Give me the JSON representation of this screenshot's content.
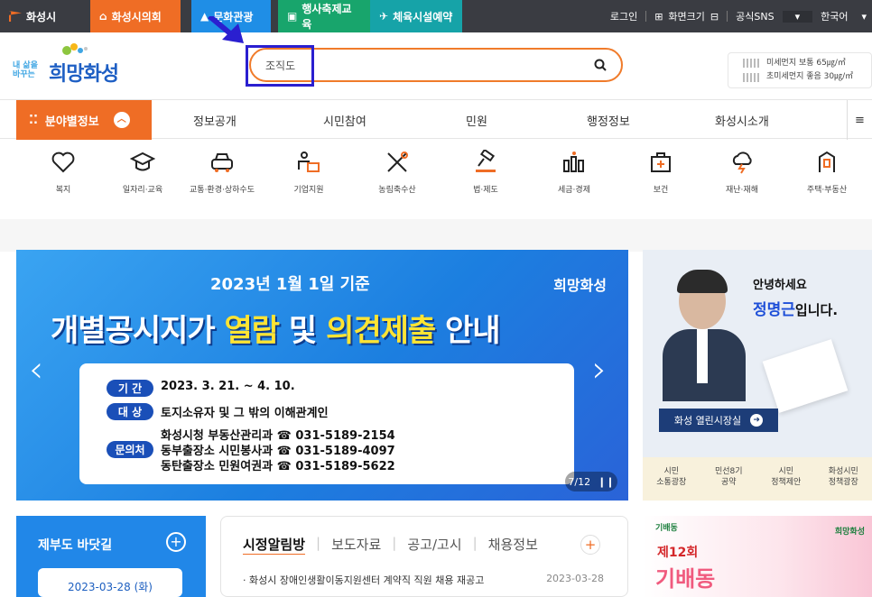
{
  "topbar": {
    "tabs": [
      {
        "label": "화성시",
        "icon": "city-flag-icon"
      },
      {
        "label": "화성시의회",
        "icon": "council-icon"
      },
      {
        "label": "문화관광",
        "icon": "mountain-icon"
      },
      {
        "label": "행사축제교육",
        "icon": "calendar-icon"
      },
      {
        "label": "체육시설예약",
        "icon": "run-icon"
      }
    ],
    "login": "로그인",
    "zoom_label": "화면크기",
    "sns": "공식SNS",
    "language": "한국어"
  },
  "header": {
    "logo_small": "내 삶을 바꾸는",
    "logo_big": "희망화성",
    "search_value": "조직도",
    "dust_line1": "미세먼지 보통 65㎍/㎥",
    "dust_line2": "초미세먼지 좋음 30㎍/㎥"
  },
  "nav": {
    "field_label": "분야별정보",
    "items": [
      "정보공개",
      "시민참여",
      "민원",
      "행정정보",
      "화성시소개"
    ]
  },
  "categories": [
    {
      "label": "복지",
      "icon": "heart-hand-icon"
    },
    {
      "label": "일자리·교육",
      "icon": "graduation-cap-icon"
    },
    {
      "label": "교통·환경·상하수도",
      "icon": "car-icon"
    },
    {
      "label": "기업지원",
      "icon": "briefcase-person-icon"
    },
    {
      "label": "농림축수산",
      "icon": "tools-icon"
    },
    {
      "label": "법·제도",
      "icon": "gavel-icon"
    },
    {
      "label": "세금·경제",
      "icon": "coins-icon"
    },
    {
      "label": "보건",
      "icon": "first-aid-icon"
    },
    {
      "label": "재난·재해",
      "icon": "storm-icon"
    },
    {
      "label": "주택·부동산",
      "icon": "building-icon"
    }
  ],
  "banner": {
    "date_line": "2023년 1월 1일 기준",
    "title_part1": "개별공시지가 ",
    "title_highlight1": "열람",
    "title_part2": " 및 ",
    "title_highlight2": "의견제출",
    "title_part3": " 안내",
    "logo": "희망화성",
    "rows": [
      {
        "pill": "기 간",
        "text": "2023. 3. 21. ~ 4. 10."
      },
      {
        "pill": "대 상",
        "text": "토지소유자 및 그 밖의 이해관계인"
      },
      {
        "pill": "문의처",
        "text": "화성시청 부동산관리과 ☎ 031-5189-2154\n동부출장소 시민봉사과 ☎ 031-5189-4097\n동탄출장소 민원여권과 ☎ 031-5189-5622"
      }
    ],
    "pager": "7/12",
    "pause": "❙❙"
  },
  "mayor": {
    "greeting": "안녕하세요",
    "name": "정명근",
    "suffix": "입니다.",
    "button": "화성 열린시장실",
    "links": [
      "시민\n소통광장",
      "민선8기\n공약",
      "시민\n정책제안",
      "화성시민\n정책광장"
    ]
  },
  "jeju": {
    "title": "제부도 바닷길",
    "date": "2023-03-28 (화)"
  },
  "news": {
    "tabs": [
      "시정알림방",
      "보도자료",
      "공고/고시",
      "채용정보"
    ],
    "item": "· 화성시 장애인생활이동지원센터 계약직 직원 채용 재공고",
    "item_date": "2023-03-28"
  },
  "promo": {
    "badge": "기배동",
    "round": "제12회",
    "big": "기배동",
    "logo": "희망화성"
  }
}
